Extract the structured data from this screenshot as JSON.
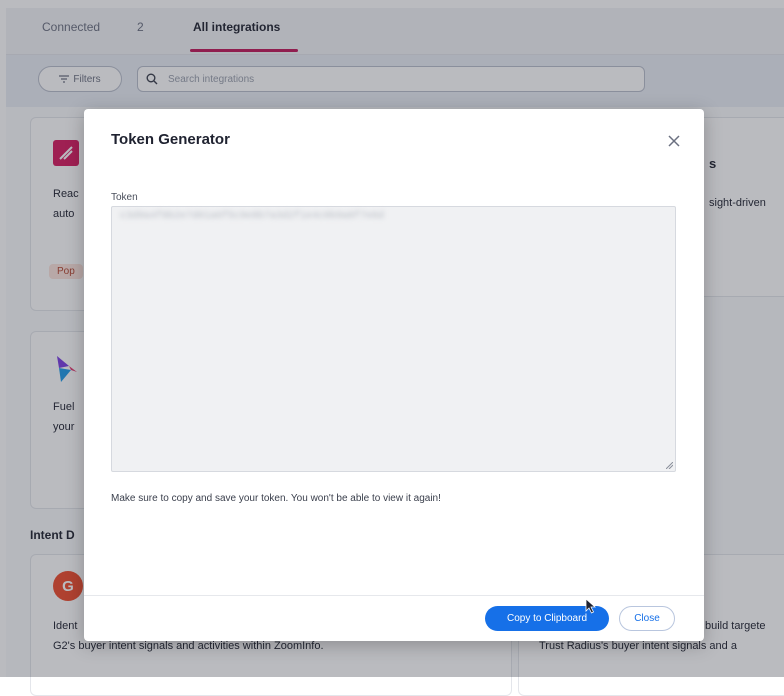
{
  "tabs": {
    "connected_label": "Connected",
    "connected_count": "2",
    "all_label": "All integrations"
  },
  "toolbar": {
    "filters_label": "Filters",
    "search_placeholder": "Search integrations"
  },
  "cards": {
    "card1_text_a": "Reac",
    "card1_text_b": "auto",
    "card1_badge": "Pop",
    "card2_title": "s",
    "card2_text": "sight-driven",
    "card3_text_a": "Fuel",
    "card3_text_b": "your",
    "section_title": "Intent D",
    "g2_text_a": "Ident",
    "g2_text_b": "G2's buyer intent signals and activities within ZoomInfo.",
    "tr_text_a": "build targete",
    "tr_text_b": "Trust Radius's buyer intent signals and a"
  },
  "modal": {
    "title": "Token Generator",
    "token_label": "Token",
    "token_value": "c3d9a4f8b2e7d01a6f5c9e8b7a3d2f1e4c0b9a8f7e6d",
    "notice": "Make sure to copy and save your token. You won't be able to view it again!",
    "copy_label": "Copy to Clipboard",
    "close_label": "Close"
  },
  "colors": {
    "accent": "#1670e8",
    "tab_underline": "#c2185b"
  }
}
